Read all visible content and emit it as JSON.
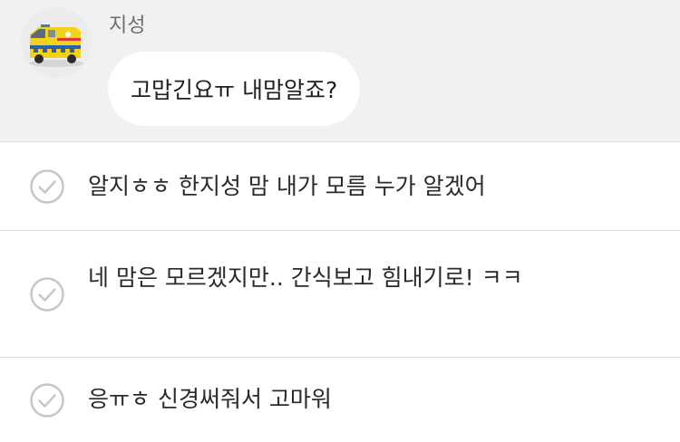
{
  "message": {
    "sender_name": "지성",
    "text": "고맙긴요ㅠ 내맘알죠?",
    "avatar_icon": "ambulance-icon"
  },
  "replies": [
    {
      "text": "알지ㅎㅎ 한지성 맘 내가 모름 누가 알겠어",
      "icon": "check-circle-icon"
    },
    {
      "text": "네 맘은 모르겠지만.. 간식보고 힘내기로! ㅋㅋ",
      "icon": "check-circle-icon"
    },
    {
      "text": "응ㅠㅎ 신경써줘서 고마워",
      "icon": "check-circle-icon"
    }
  ],
  "colors": {
    "chat_background": "#f1f1f1",
    "bubble_background": "#ffffff",
    "check_color": "#c7c7c7",
    "ambulance_yellow": "#f2d21a"
  }
}
